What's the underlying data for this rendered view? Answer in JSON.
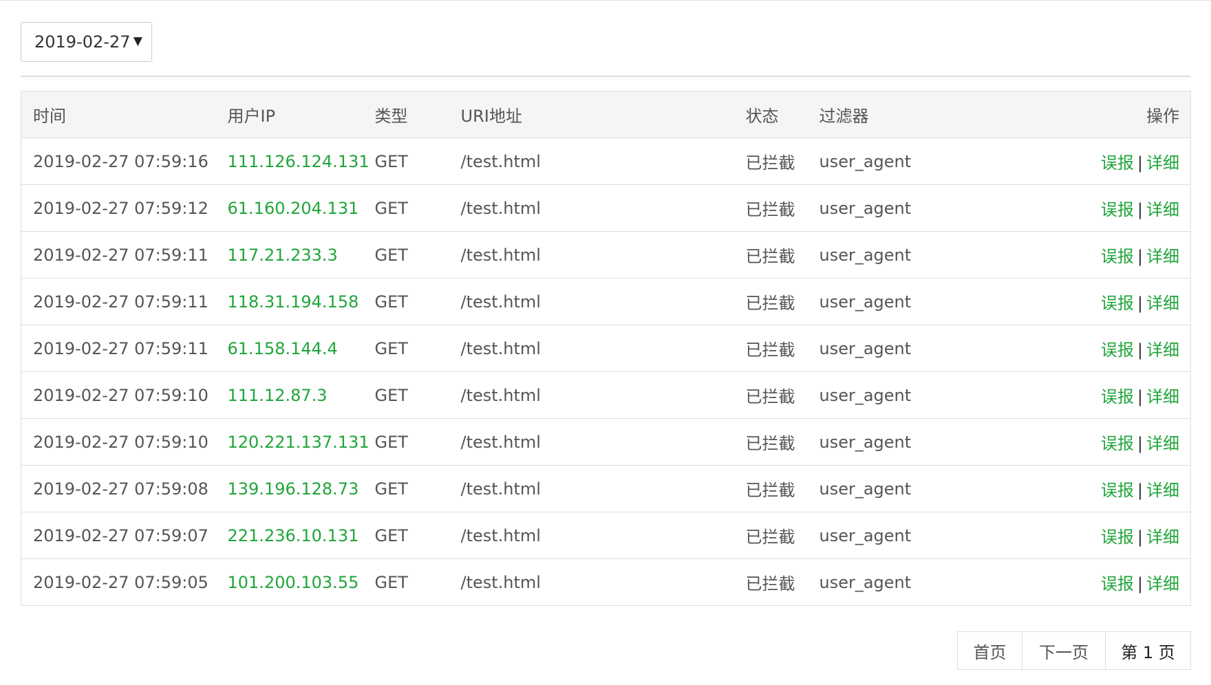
{
  "filter": {
    "date": "2019-02-27",
    "caret": "▼"
  },
  "table": {
    "headers": {
      "time": "时间",
      "ip": "用户IP",
      "type": "类型",
      "uri": "URI地址",
      "status": "状态",
      "filter": "过滤器",
      "actions": "操作"
    },
    "rows": [
      {
        "time": "2019-02-27 07:59:16",
        "ip": "111.126.124.131",
        "type": "GET",
        "uri": "/test.html",
        "status": "已拦截",
        "filter": "user_agent"
      },
      {
        "time": "2019-02-27 07:59:12",
        "ip": "61.160.204.131",
        "type": "GET",
        "uri": "/test.html",
        "status": "已拦截",
        "filter": "user_agent"
      },
      {
        "time": "2019-02-27 07:59:11",
        "ip": "117.21.233.3",
        "type": "GET",
        "uri": "/test.html",
        "status": "已拦截",
        "filter": "user_agent"
      },
      {
        "time": "2019-02-27 07:59:11",
        "ip": "118.31.194.158",
        "type": "GET",
        "uri": "/test.html",
        "status": "已拦截",
        "filter": "user_agent"
      },
      {
        "time": "2019-02-27 07:59:11",
        "ip": "61.158.144.4",
        "type": "GET",
        "uri": "/test.html",
        "status": "已拦截",
        "filter": "user_agent"
      },
      {
        "time": "2019-02-27 07:59:10",
        "ip": "111.12.87.3",
        "type": "GET",
        "uri": "/test.html",
        "status": "已拦截",
        "filter": "user_agent"
      },
      {
        "time": "2019-02-27 07:59:10",
        "ip": "120.221.137.131",
        "type": "GET",
        "uri": "/test.html",
        "status": "已拦截",
        "filter": "user_agent"
      },
      {
        "time": "2019-02-27 07:59:08",
        "ip": "139.196.128.73",
        "type": "GET",
        "uri": "/test.html",
        "status": "已拦截",
        "filter": "user_agent"
      },
      {
        "time": "2019-02-27 07:59:07",
        "ip": "221.236.10.131",
        "type": "GET",
        "uri": "/test.html",
        "status": "已拦截",
        "filter": "user_agent"
      },
      {
        "time": "2019-02-27 07:59:05",
        "ip": "101.200.103.55",
        "type": "GET",
        "uri": "/test.html",
        "status": "已拦截",
        "filter": "user_agent"
      }
    ],
    "actions": {
      "report": "误报",
      "separator": "|",
      "detail": "详细"
    }
  },
  "pagination": {
    "first": "首页",
    "next": "下一页",
    "current": "第 1 页"
  },
  "colors": {
    "accent": "#20a53a",
    "header_bg": "#f5f5f5",
    "border": "#dddddd",
    "text": "#555555"
  }
}
